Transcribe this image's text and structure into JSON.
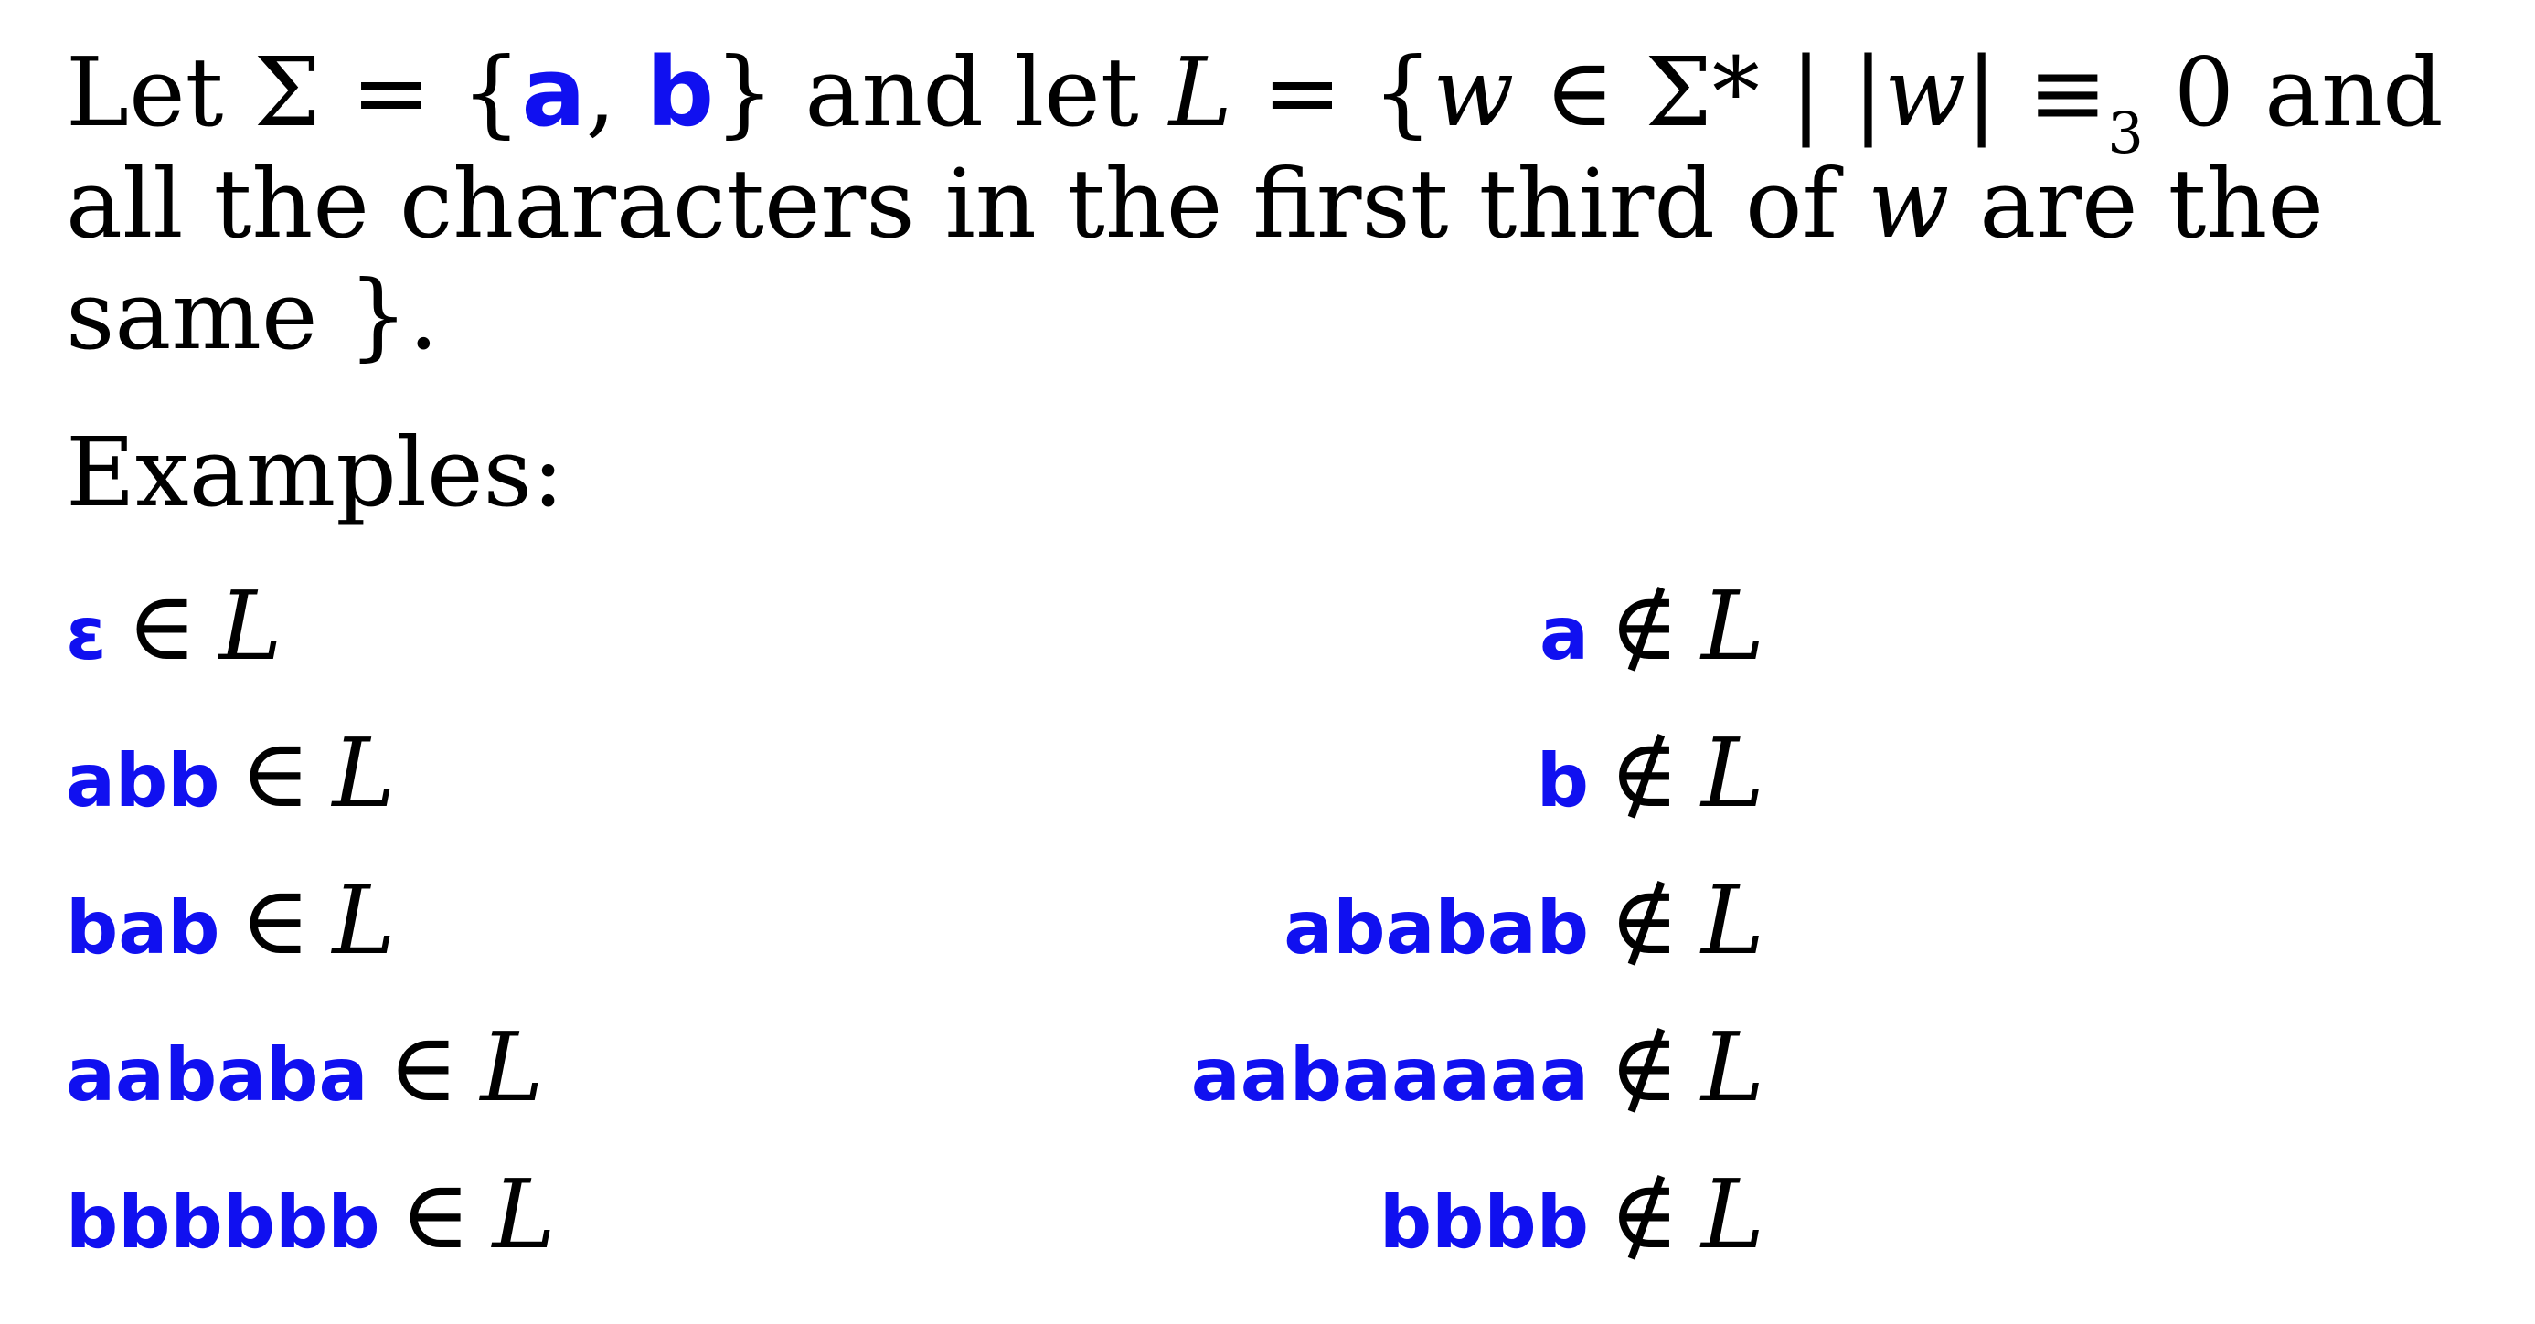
{
  "definition": {
    "line1": {
      "let1": "Let ",
      "sigma": "Σ",
      "eq_open": " = {",
      "sym_a": "a",
      "comma": ", ",
      "sym_b": "b",
      "close_and_let": "} and let ",
      "lang": "L",
      "eq_open2": " = {",
      "w1": "w",
      "in_sigma_star": " ∈ Σ* | |",
      "w2": "w",
      "equiv": "| ≡",
      "sub3": "3",
      "rest": " 0 and"
    },
    "line2": {
      "text": "all the characters in the first third of ",
      "w": "w",
      "rest": " are the"
    },
    "line3": {
      "text": "same }."
    }
  },
  "examples_heading": "Examples:",
  "member_symbol": "∈",
  "nonmember_symbol": "∉",
  "language_symbol": "L",
  "members": [
    "ε",
    "abb",
    "bab",
    "aababa",
    "bbbbbb"
  ],
  "nonmembers": [
    "a",
    "b",
    "ababab",
    "aabaaaaa",
    "bbbb"
  ],
  "colors": {
    "symbol": "#1010f0",
    "text": "#000000",
    "background": "#ffffff"
  }
}
